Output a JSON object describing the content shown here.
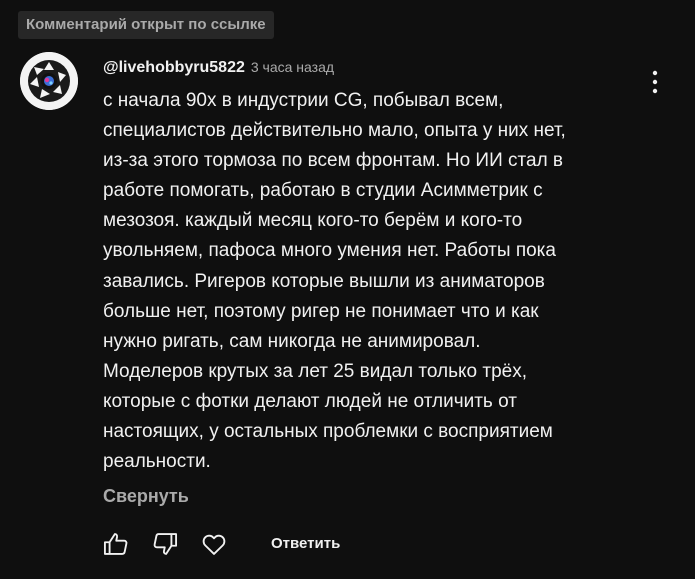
{
  "badge": "Комментарий открыт по ссылке",
  "comment": {
    "author": "@livehobbyru5822",
    "timestamp": "3 часа назад",
    "lines": [
      "с начала 90х в индустрии CG, побывал всем,",
      "специалистов действительно мало, опыта у них нет,",
      "из-за этого тормоза по всем фронтам. Но ИИ стал в",
      "работе помогать, работаю в студии Асимметрик с",
      "мезозоя. каждый месяц кого-то берём и кого-то",
      "увольняем, пафоса много умения нет. Работы пока",
      "завались. Ригеров которые вышли из аниматоров",
      "больше нет, поэтому ригер не понимает что и как",
      "нужно ригать, сам никогда не анимировал.",
      "Моделеров крутых за лет 25 видал только трёх,",
      "которые с фотки делают людей не отличить от",
      "настоящих, у остальных проблемки с восприятием",
      "реальности."
    ],
    "collapse_label": "Свернуть",
    "reply_label": "Ответить"
  },
  "icons": {
    "avatar": "camera-lens-logo",
    "more": "vertical-ellipsis-icon",
    "like": "thumbs-up-icon",
    "dislike": "thumbs-down-icon",
    "heart": "heart-icon"
  },
  "colors": {
    "background": "#0f0f0f",
    "primary_text": "#f1f1f1",
    "secondary_text": "#aaaaaa",
    "badge_background": "#272727"
  }
}
